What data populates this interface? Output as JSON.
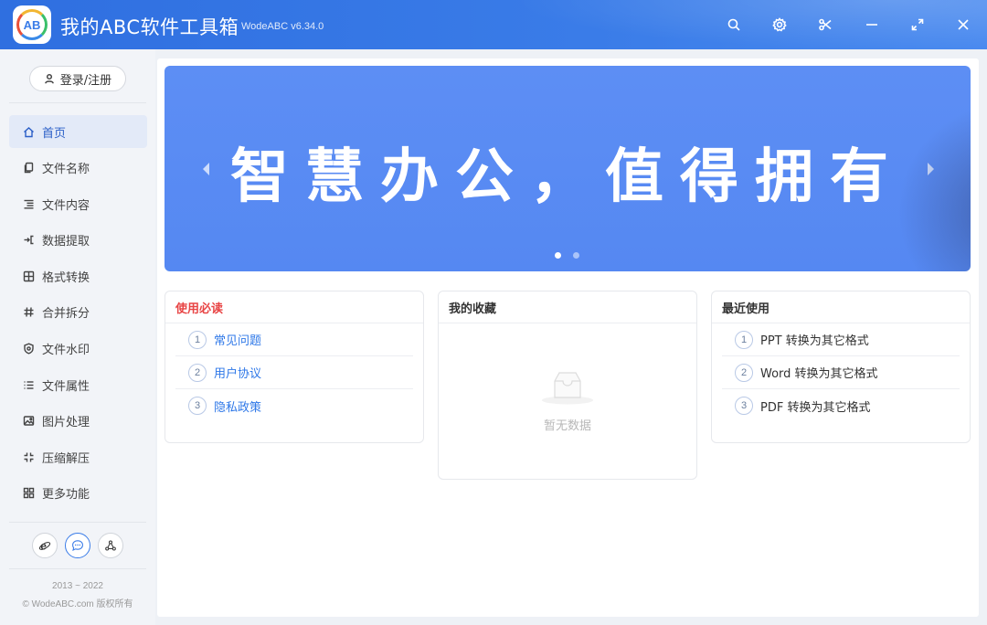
{
  "app": {
    "title": "我的ABC软件工具箱",
    "version": "WodeABC v6.34.0",
    "logo_text": "AB"
  },
  "window_controls": [
    "search-icon",
    "settings-icon",
    "scissors-icon",
    "minimize-icon",
    "maximize-icon",
    "close-icon"
  ],
  "sidebar": {
    "login_label": "登录/注册",
    "items": [
      {
        "label": "首页",
        "icon": "home-icon",
        "active": true
      },
      {
        "label": "文件名称",
        "icon": "file-copy-icon"
      },
      {
        "label": "文件内容",
        "icon": "text-lines-icon"
      },
      {
        "label": "数据提取",
        "icon": "extract-icon"
      },
      {
        "label": "格式转换",
        "icon": "format-icon"
      },
      {
        "label": "合并拆分",
        "icon": "hash-icon"
      },
      {
        "label": "文件水印",
        "icon": "shield-icon"
      },
      {
        "label": "文件属性",
        "icon": "list-icon"
      },
      {
        "label": "图片处理",
        "icon": "image-icon"
      },
      {
        "label": "压缩解压",
        "icon": "compress-icon"
      },
      {
        "label": "更多功能",
        "icon": "grid-icon"
      }
    ],
    "social": [
      "ie-icon",
      "chat-icon",
      "share-icon"
    ],
    "copyright_years": "2013 ~ 2022",
    "copyright_text": "© WodeABC.com 版权所有"
  },
  "banner": {
    "text": "智慧办公，值得拥有",
    "slides": 2,
    "active_slide": 1
  },
  "cards": {
    "must_read": {
      "title": "使用必读",
      "items": [
        {
          "num": "1",
          "label": "常见问题"
        },
        {
          "num": "2",
          "label": "用户协议"
        },
        {
          "num": "3",
          "label": "隐私政策"
        }
      ]
    },
    "favorites": {
      "title": "我的收藏",
      "empty_text": "暂无数据"
    },
    "recent": {
      "title": "最近使用",
      "items": [
        {
          "num": "1",
          "label": "PPT 转换为其它格式"
        },
        {
          "num": "2",
          "label": "Word 转换为其它格式"
        },
        {
          "num": "3",
          "label": "PDF 转换为其它格式"
        }
      ]
    }
  },
  "colors": {
    "titlebar": "#3a7ce8",
    "banner": "#5a8cf3",
    "accent_red": "#e84545",
    "link_blue": "#2f78e8",
    "active_nav_bg": "#e3eaf8"
  }
}
